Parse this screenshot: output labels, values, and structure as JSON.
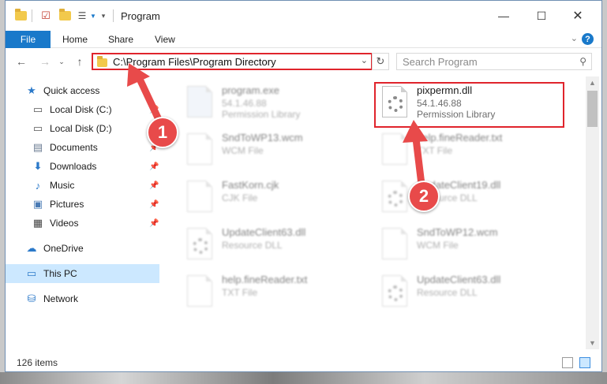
{
  "window": {
    "title": "Program"
  },
  "ribbon": {
    "tabs": [
      "File",
      "Home",
      "Share",
      "View"
    ],
    "help": "?"
  },
  "nav": {
    "address": "C:\\Program Files\\Program Directory",
    "search_placeholder": "Search Program"
  },
  "sidebar": {
    "items": [
      {
        "label": "Quick access",
        "icon": "star-icon",
        "pinned": false
      },
      {
        "label": "Local Disk (C:)",
        "icon": "drive-icon",
        "pinned": true
      },
      {
        "label": "Local Disk (D:)",
        "icon": "drive-icon",
        "pinned": true
      },
      {
        "label": "Documents",
        "icon": "documents-icon",
        "pinned": true
      },
      {
        "label": "Downloads",
        "icon": "download-icon",
        "pinned": true
      },
      {
        "label": "Music",
        "icon": "music-icon",
        "pinned": true
      },
      {
        "label": "Pictures",
        "icon": "pictures-icon",
        "pinned": true
      },
      {
        "label": "Videos",
        "icon": "videos-icon",
        "pinned": true
      },
      {
        "label": "OneDrive",
        "icon": "cloud-icon",
        "pinned": false
      },
      {
        "label": "This PC",
        "icon": "computer-icon",
        "pinned": false,
        "selected": true
      },
      {
        "label": "Network",
        "icon": "network-icon",
        "pinned": false
      }
    ]
  },
  "files": [
    {
      "name": "program.exe",
      "sub1": "54.1.46.88",
      "sub2": "Permission Library",
      "kind": "exe",
      "blurred": true
    },
    {
      "name": "pixpermn.dll",
      "sub1": "54.1.46.88",
      "sub2": "Permission Library",
      "kind": "dll",
      "blurred": false,
      "highlighted": true
    },
    {
      "name": "SndToWP13.wcm",
      "sub1": "WCM File",
      "sub2": "",
      "kind": "file",
      "blurred": true
    },
    {
      "name": "help.fineReader.txt",
      "sub1": "TXT File",
      "sub2": "",
      "kind": "file",
      "blurred": true
    },
    {
      "name": "FastKorn.cjk",
      "sub1": "CJK File",
      "sub2": "",
      "kind": "file",
      "blurred": true
    },
    {
      "name": "UpdateClient19.dll",
      "sub1": "Resource DLL",
      "sub2": "",
      "kind": "dll",
      "blurred": true
    },
    {
      "name": "UpdateClient63.dll",
      "sub1": "Resource DLL",
      "sub2": "",
      "kind": "dll",
      "blurred": true
    },
    {
      "name": "SndToWP12.wcm",
      "sub1": "WCM File",
      "sub2": "",
      "kind": "file",
      "blurred": true
    },
    {
      "name": "help.fineReader.txt",
      "sub1": "TXT File",
      "sub2": "",
      "kind": "file",
      "blurred": true
    },
    {
      "name": "UpdateClient63.dll",
      "sub1": "Resource DLL",
      "sub2": "",
      "kind": "dll",
      "blurred": true
    }
  ],
  "status": {
    "count": "126 items"
  },
  "annotations": {
    "step1": "1",
    "step2": "2"
  },
  "colors": {
    "accent": "#1979ca",
    "highlight": "#e0242c",
    "badge": "#e84a4a",
    "selection": "#cce8ff"
  }
}
